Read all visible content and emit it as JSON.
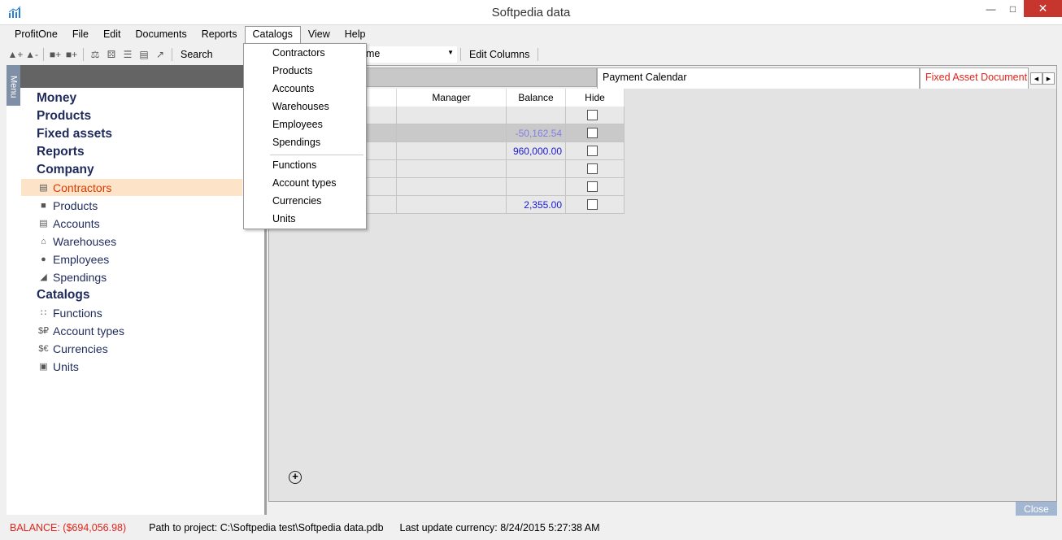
{
  "window": {
    "title": "Softpedia data",
    "icon": "bar-chart-icon"
  },
  "menubar": [
    "ProfitOne",
    "File",
    "Edit",
    "Documents",
    "Reports",
    "Catalogs",
    "View",
    "Help"
  ],
  "toolbar": {
    "search_label": "Search",
    "combo_value": "me",
    "edit_columns_label": "Edit Columns"
  },
  "sidebar": {
    "tab_label": "Menu",
    "groups": {
      "money": "Money",
      "products": "Products",
      "fixed_assets": "Fixed assets",
      "reports": "Reports",
      "company": "Company",
      "catalogs": "Catalogs"
    },
    "company_items": [
      "Contractors",
      "Products",
      "Accounts",
      "Warehouses",
      "Employees",
      "Spendings"
    ],
    "catalog_items": [
      "Functions",
      "Account types",
      "Currencies",
      "Units"
    ]
  },
  "tabs": {
    "payment_calendar": "Payment Calendar",
    "fixed_asset_document": "Fixed Asset Document"
  },
  "grid": {
    "columns": [
      "",
      "Manager",
      "Balance",
      "Hide"
    ],
    "rows": [
      {
        "balance": ""
      },
      {
        "balance": "-50,162.54"
      },
      {
        "balance": "960,000.00"
      },
      {
        "balance": ""
      },
      {
        "balance": ""
      },
      {
        "balance": "2,355.00"
      }
    ]
  },
  "add_button": "⊕",
  "close_button": "Close",
  "dropdown": {
    "items_top": [
      "Contractors",
      "Products",
      "Accounts",
      "Warehouses",
      "Employees",
      "Spendings"
    ],
    "items_bottom": [
      "Functions",
      "Account types",
      "Currencies",
      "Units"
    ]
  },
  "status": {
    "balance": "BALANCE: ($694,056.98)",
    "path": "Path to project: C:\\Softpedia test\\Softpedia data.pdb",
    "last_update": "Last update currency: 8/24/2015 5:27:38 AM"
  },
  "colors": {
    "accent_red": "#e0241b",
    "nav_blue": "#1f2a5c",
    "selected_bg": "#fde3c8",
    "close_btn": "#a3b6d2"
  }
}
